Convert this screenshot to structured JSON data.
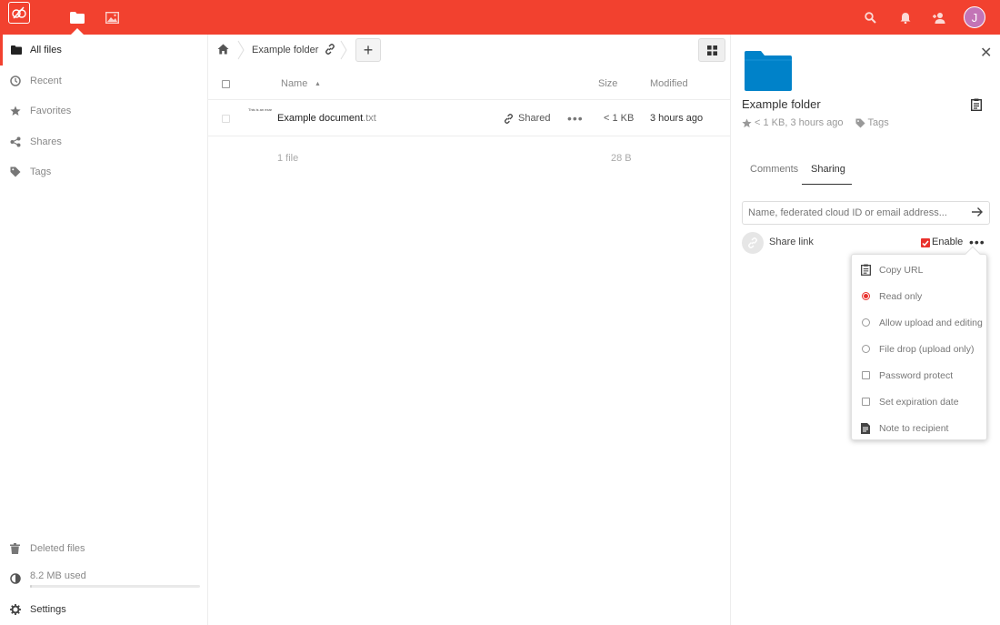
{
  "header": {
    "avatar_initial": "J",
    "accent": "#f2412f"
  },
  "sidebar": {
    "items": [
      {
        "label": "All files",
        "icon": "folder-icon"
      },
      {
        "label": "Recent",
        "icon": "clock-icon"
      },
      {
        "label": "Favorites",
        "icon": "star-icon"
      },
      {
        "label": "Shares",
        "icon": "share-icon"
      },
      {
        "label": "Tags",
        "icon": "tag-icon"
      }
    ],
    "deleted_files": "Deleted files",
    "quota": "8.2 MB used",
    "settings": "Settings"
  },
  "breadcrumb": {
    "folder": "Example folder"
  },
  "table": {
    "columns": {
      "name": "Name",
      "size": "Size",
      "modified": "Modified"
    },
    "rows": [
      {
        "thumb_text": "This is an example",
        "name": "Example document",
        "ext": ".txt",
        "shared_label": "Shared",
        "size": "< 1 KB",
        "modified": "3 hours ago"
      }
    ],
    "summary": {
      "count": "1 file",
      "size": "28 B"
    }
  },
  "details": {
    "title": "Example folder",
    "meta": "< 1 KB, 3 hours ago",
    "tags_label": "Tags",
    "tabs": {
      "comments": "Comments",
      "sharing": "Sharing"
    },
    "share_placeholder": "Name, federated cloud ID or email address...",
    "share_link_label": "Share link",
    "enable_label": "Enable",
    "menu": {
      "copy_url": "Copy URL",
      "read_only": "Read only",
      "allow_upload": "Allow upload and editing",
      "file_drop": "File drop (upload only)",
      "password": "Password protect",
      "expiration": "Set expiration date",
      "note": "Note to recipient"
    },
    "folder_color": "#0082c9"
  }
}
